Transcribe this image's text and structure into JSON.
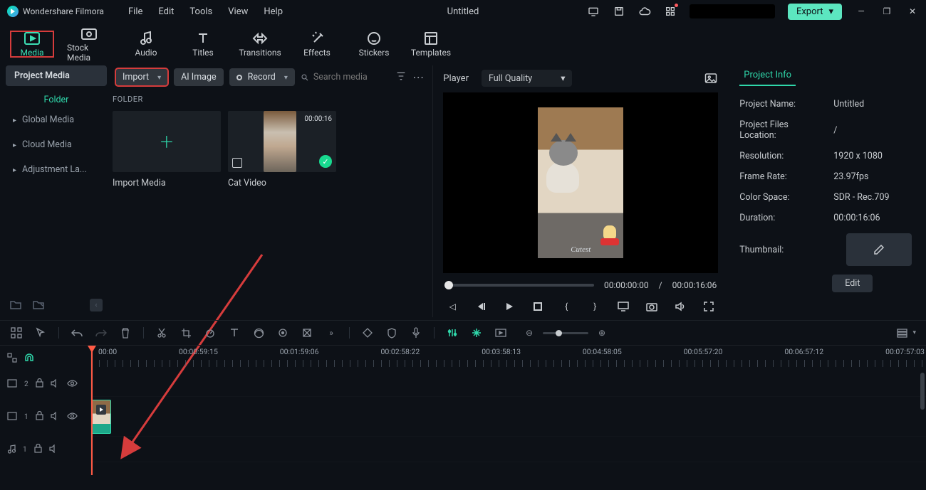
{
  "app": {
    "name": "Wondershare Filmora",
    "document_title": "Untitled"
  },
  "menu": [
    "File",
    "Edit",
    "Tools",
    "View",
    "Help"
  ],
  "export_label": "Export",
  "toptabs": [
    {
      "id": "media",
      "label": "Media"
    },
    {
      "id": "stock",
      "label": "Stock Media"
    },
    {
      "id": "audio",
      "label": "Audio"
    },
    {
      "id": "titles",
      "label": "Titles"
    },
    {
      "id": "transitions",
      "label": "Transitions"
    },
    {
      "id": "effects",
      "label": "Effects"
    },
    {
      "id": "stickers",
      "label": "Stickers"
    },
    {
      "id": "templates",
      "label": "Templates"
    }
  ],
  "sidebar": {
    "heading": "Project Media",
    "folder_link": "Folder",
    "items": [
      "Global Media",
      "Cloud Media",
      "Adjustment La..."
    ]
  },
  "media_toolbar": {
    "import": "Import",
    "ai_image": "AI Image",
    "record": "Record",
    "search_placeholder": "Search media"
  },
  "folder_section_label": "FOLDER",
  "thumbs": {
    "import_media": "Import Media",
    "cat_video": {
      "label": "Cat Video",
      "duration": "00:00:16"
    }
  },
  "preview": {
    "player_label": "Player",
    "quality": "Full Quality",
    "caption": "Cutest",
    "current": "00:00:00:00",
    "divider": "/",
    "total": "00:00:16:06"
  },
  "project_info": {
    "tab": "Project Info",
    "fields": {
      "name": {
        "k": "Project Name:",
        "v": "Untitled"
      },
      "location": {
        "k": "Project Files Location:",
        "v": "/"
      },
      "res": {
        "k": "Resolution:",
        "v": "1920 x 1080"
      },
      "fps": {
        "k": "Frame Rate:",
        "v": "23.97fps"
      },
      "cs": {
        "k": "Color Space:",
        "v": "SDR - Rec.709"
      },
      "dur": {
        "k": "Duration:",
        "v": "00:00:16:06"
      },
      "thumb": {
        "k": "Thumbnail:"
      }
    },
    "edit": "Edit"
  },
  "ruler": [
    "00:00",
    "00:00:59:15",
    "00:01:59:06",
    "00:02:58:22",
    "00:03:58:13",
    "00:04:58:05",
    "00:05:57:20",
    "00:06:57:12",
    "00:07:57:03"
  ]
}
